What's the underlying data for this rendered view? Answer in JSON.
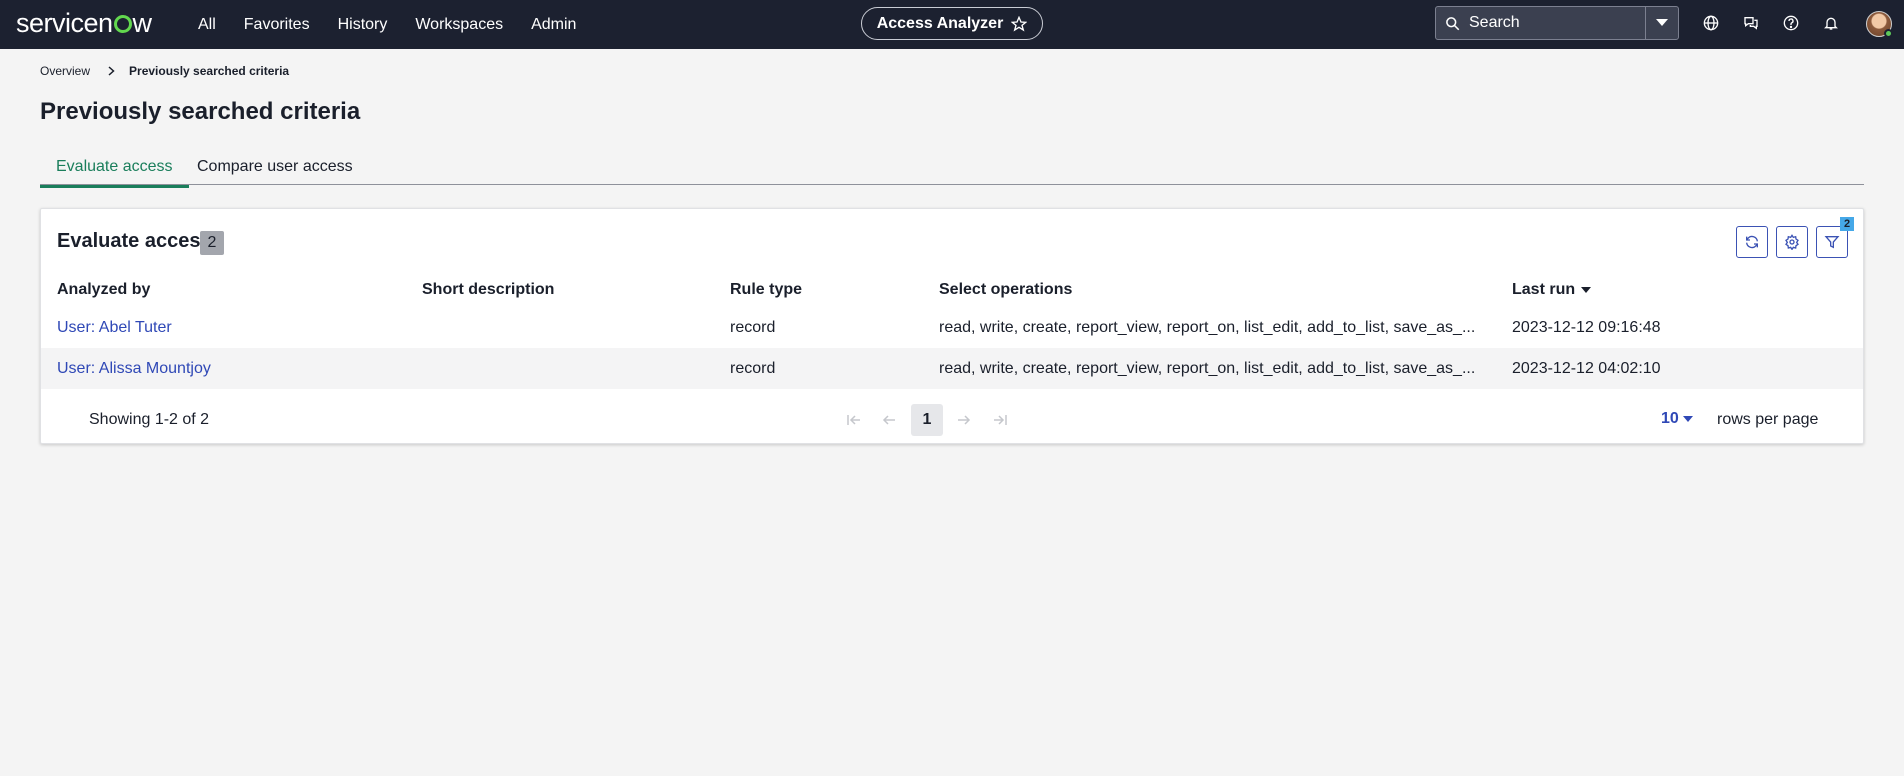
{
  "topnav": {
    "logo_prefix": "servicen",
    "logo_suffix": "w",
    "links": [
      "All",
      "Favorites",
      "History",
      "Workspaces",
      "Admin"
    ],
    "app_name": "Access Analyzer",
    "search_placeholder": "Search"
  },
  "breadcrumb": {
    "items": [
      "Overview"
    ],
    "current": "Previously searched criteria"
  },
  "page_title": "Previously searched criteria",
  "tabs": [
    {
      "label": "Evaluate access",
      "active": true
    },
    {
      "label": "Compare user access",
      "active": false
    }
  ],
  "card": {
    "title": "Evaluate access",
    "count": "2",
    "filter_count": "2"
  },
  "table": {
    "columns": [
      "Analyzed by",
      "Short description",
      "Rule type",
      "Select operations",
      "Last run"
    ],
    "rows": [
      {
        "analyzed_by": "User: Abel Tuter",
        "short_description": "",
        "rule_type": "record",
        "operations": "read, write, create, report_view, report_on, list_edit, add_to_list, save_as_...",
        "last_run": "2023-12-12 09:16:48"
      },
      {
        "analyzed_by": "User: Alissa Mountjoy",
        "short_description": "",
        "rule_type": "record",
        "operations": "read, write, create, report_view, report_on, list_edit, add_to_list, save_as_...",
        "last_run": "2023-12-12 04:02:10"
      }
    ]
  },
  "pager": {
    "showing": "Showing 1-2 of 2",
    "current_page": "1",
    "rows_per_page": "10",
    "rows_label": "rows per page"
  },
  "colors": {
    "nav_bg": "#1c2130",
    "accent_green": "#1a7e5b",
    "link_blue": "#2f48b6"
  }
}
